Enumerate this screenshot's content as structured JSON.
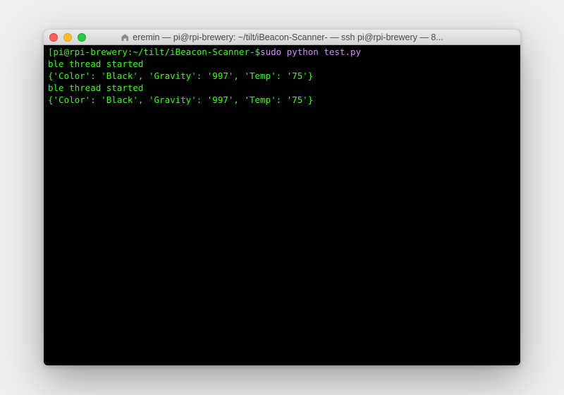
{
  "titlebar": {
    "title": "eremin — pi@rpi-brewery: ~/tilt/iBeacon-Scanner- — ssh pi@rpi-brewery — 8..."
  },
  "terminal": {
    "prompt_open": "[",
    "prompt_user_host": "pi@rpi-brewery",
    "prompt_sep": ":",
    "prompt_path": "~/tilt/iBeacon-Scanner-",
    "prompt_close": " $ ",
    "command": "sudo python test.py",
    "output": [
      "ble thread started",
      "{'Color': 'Black', 'Gravity': '997', 'Temp': '75'}",
      "ble thread started",
      "{'Color': 'Black', 'Gravity': '997', 'Temp': '75'}"
    ]
  }
}
